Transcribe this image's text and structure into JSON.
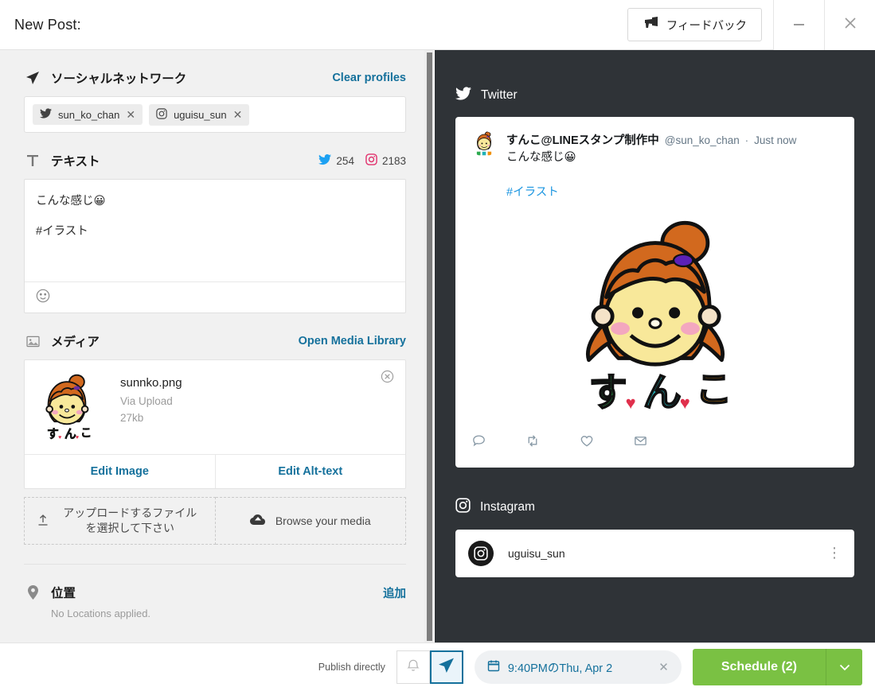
{
  "window": {
    "title": "New Post:",
    "feedback_label": "フィードバック",
    "minimize_label": "–",
    "close_label": "✕"
  },
  "editor": {
    "social": {
      "title": "ソーシャルネットワーク",
      "action": "Clear profiles",
      "icon": "send-icon",
      "profiles": [
        {
          "network": "twitter",
          "name": "sun_ko_chan",
          "remove": "✕"
        },
        {
          "network": "instagram",
          "name": "uguisu_sun",
          "remove": "✕"
        }
      ]
    },
    "text": {
      "title": "テキスト",
      "icon": "text-format-icon",
      "counters": [
        {
          "network": "twitter",
          "value": "254"
        },
        {
          "network": "instagram",
          "value": "2183"
        }
      ],
      "line1": "こんな感じ😀",
      "line2": "#イラスト",
      "emoji_button": "☺"
    },
    "media": {
      "title": "メディア",
      "action": "Open Media Library",
      "icon": "image-icon",
      "item": {
        "filename": "sunnko.png",
        "source": "Via Upload",
        "size": "27kb",
        "remove": "⊗"
      },
      "edit_image": "Edit Image",
      "edit_alt": "Edit Alt-text",
      "upload_label": "アップロードするファイルを選択して下さい",
      "browse_label": "Browse your media"
    },
    "location": {
      "title": "位置",
      "action": "追加",
      "note": "No Locations applied.",
      "icon": "map-pin-icon"
    }
  },
  "preview": {
    "twitter": {
      "network_label": "Twitter",
      "display_name": "すんこ@LINEスタンプ制作中",
      "handle": "@sun_ko_chan",
      "separator": "·",
      "time": "Just now",
      "text": "こんな感じ😀",
      "hashtag": "#イラスト",
      "actions": [
        "reply-icon",
        "retweet-icon",
        "like-icon",
        "share-icon"
      ]
    },
    "instagram": {
      "network_label": "Instagram",
      "username": "uguisu_sun",
      "more": "⋮"
    }
  },
  "footer": {
    "publish_label": "Publish directly",
    "notify_icon": "bell-icon",
    "send_icon": "send-icon",
    "date_text": "9:40PMのThu, Apr 2",
    "date_clear": "✕",
    "schedule_label": "Schedule (2)",
    "schedule_caret": "⌄"
  },
  "colors": {
    "link": "#15719c",
    "twitter": "#1da1f2",
    "instagram": "#e1306c",
    "schedule_green": "#7ac143",
    "preview_bg": "#2f3337"
  }
}
